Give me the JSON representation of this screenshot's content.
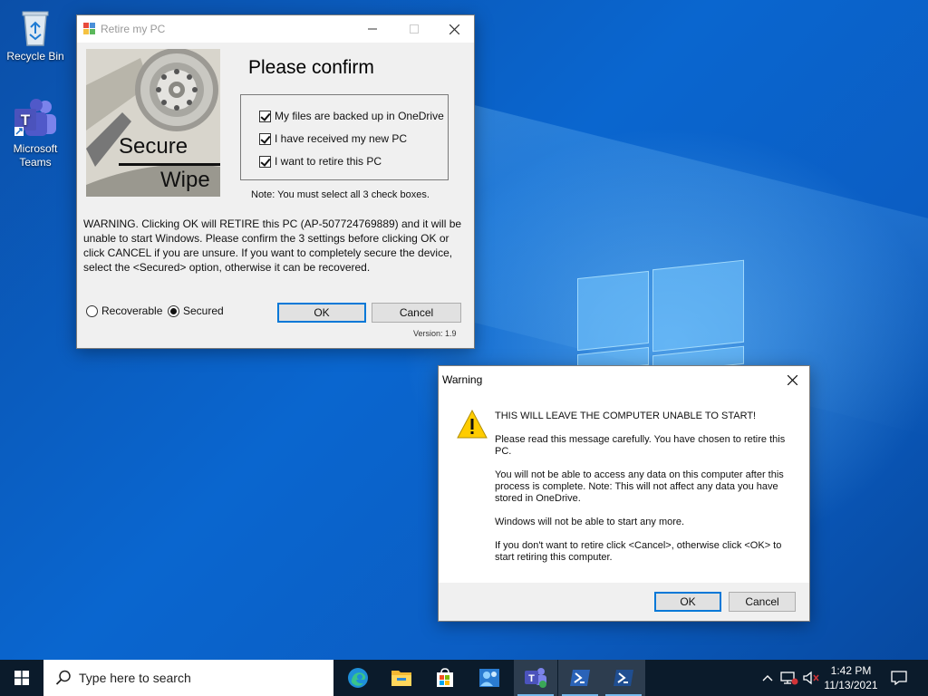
{
  "desktop": {
    "icons": [
      {
        "label": "Recycle Bin"
      },
      {
        "label_line1": "Microsoft",
        "label_line2": "Teams"
      }
    ]
  },
  "retire_window": {
    "title": "Retire my PC",
    "image_text_top": "Secure",
    "image_text_bottom": "Wipe",
    "heading": "Please confirm",
    "checkboxes": [
      {
        "label": "My files are backed up in OneDrive",
        "checked": true
      },
      {
        "label": "I have received my new PC",
        "checked": true
      },
      {
        "label": "I want to retire this PC",
        "checked": true
      }
    ],
    "note": "Note: You must select all 3 check boxes.",
    "warning": "WARNING. Clicking OK will RETIRE this PC (AP-507724769889) and it will be unable to start Windows. Please confirm the 3 settings before clicking OK or click CANCEL if you are unsure. If you want to completely secure the device, select the <Secured> option, otherwise it can be recovered.",
    "radio_recoverable": "Recoverable",
    "radio_secured": "Secured",
    "selected_option": "Secured",
    "ok_label": "OK",
    "cancel_label": "Cancel",
    "version": "Version: 1.9"
  },
  "warning_dialog": {
    "title": "Warning",
    "headline": "THIS WILL LEAVE THE COMPUTER UNABLE TO START!",
    "para1": "Please read this message carefully. You have chosen to retire this PC.",
    "para2": "You will not be able to access any data on this computer after this process is complete. Note: This will not affect any data you have stored in OneDrive.",
    "para3": "Windows will not be able to start any more.",
    "para4": "If you don't want to retire click <Cancel>, otherwise click <OK> to start retiring this computer.",
    "ok_label": "OK",
    "cancel_label": "Cancel"
  },
  "taskbar": {
    "search_placeholder": "Type here to search",
    "time": "1:42 PM",
    "date": "11/13/2021",
    "pinned_icons": [
      "edge-icon",
      "file-explorer-icon",
      "store-icon",
      "people-icon",
      "teams-icon",
      "powershell-icon",
      "powershell-active-icon"
    ]
  },
  "colors": {
    "accent": "#0078d7",
    "taskbar": "#0b1b2b",
    "dialog_bg": "#f0f0f0"
  }
}
